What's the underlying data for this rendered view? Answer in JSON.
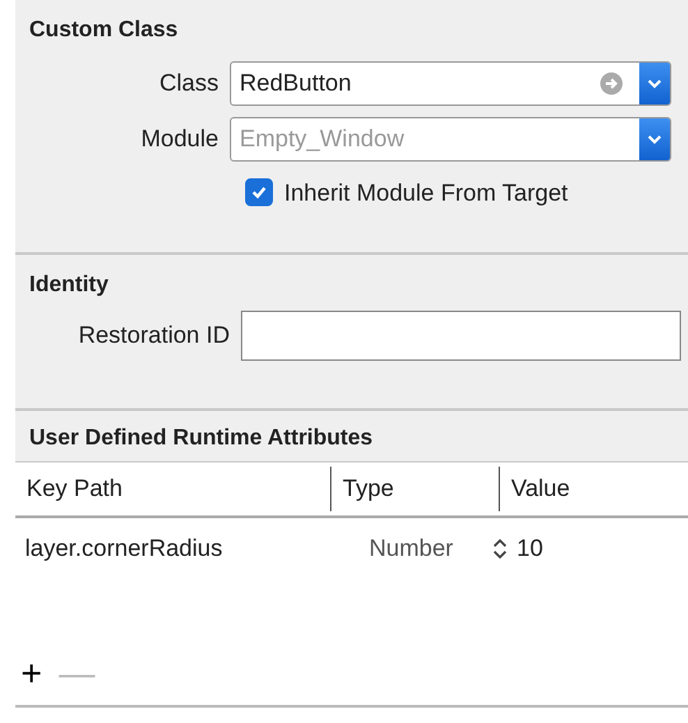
{
  "custom_class": {
    "title": "Custom Class",
    "fields": [
      {
        "kind": "combo",
        "label": "Class",
        "value": "RedButton",
        "placeholder_style": false,
        "go_icon": true
      },
      {
        "kind": "combo",
        "label": "Module",
        "value": "Empty_Window",
        "placeholder_style": true,
        "go_icon": false
      }
    ],
    "checkbox": {
      "label": "Inherit Module From Target",
      "checked": true
    }
  },
  "identity": {
    "title": "Identity",
    "fields": [
      {
        "kind": "text",
        "label": "Restoration ID"
      }
    ]
  },
  "runtime_attributes": {
    "title": "User Defined Runtime Attributes",
    "columns": [
      "Key Path",
      "Type",
      "Value"
    ],
    "rows": [
      {
        "key_path": "layer.cornerRadius",
        "type": "Number",
        "value": "10"
      }
    ],
    "buttons": [
      {
        "label": "+",
        "disabled": false
      },
      {
        "label": "—",
        "disabled": true
      }
    ]
  }
}
